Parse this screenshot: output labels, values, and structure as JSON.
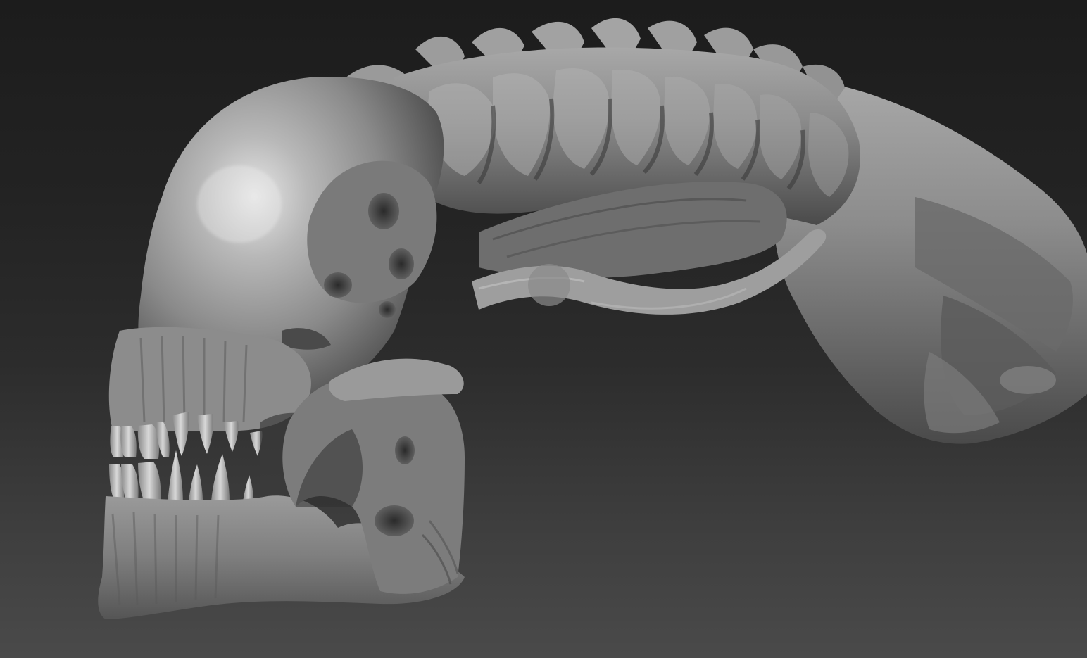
{
  "scene": {
    "subject_icon": "alien-skull-sculpt-icon",
    "colors": {
      "background_top": "#1c1c1c",
      "background_bottom": "#4a4a4a",
      "material_light": "#c4c4c4",
      "material_mid": "#8a8a8a",
      "material_dark": "#3a3a3a"
    }
  }
}
